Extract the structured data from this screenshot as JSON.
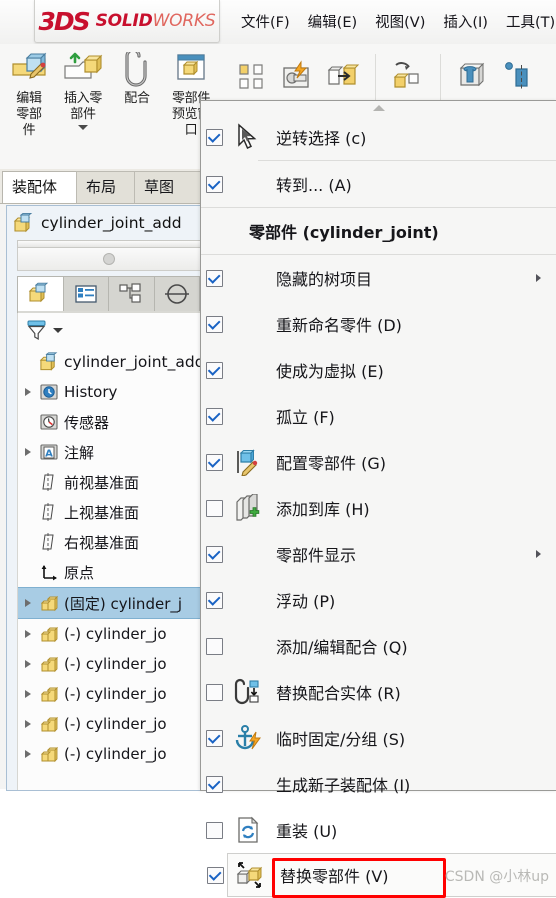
{
  "app": {
    "brand_3ds": "3DS",
    "brand_bold": "SOLID",
    "brand_light": "WORKS",
    "accent_red": "#c8102e",
    "highlight_red": "#ff0000",
    "selection_blue": "#a8cce4"
  },
  "menubar": {
    "items": [
      {
        "label": "文件(F)"
      },
      {
        "label": "编辑(E)"
      },
      {
        "label": "视图(V)"
      },
      {
        "label": "插入(I)"
      },
      {
        "label": "工具(T)"
      }
    ]
  },
  "ribbon": {
    "buttons": [
      {
        "label_line1": "编辑",
        "label_line2": "零部",
        "label_line3": "件",
        "icon": "edit-component-icon",
        "has_caret": false
      },
      {
        "label_line1": "插入零",
        "label_line2": "部件",
        "label_line3": "",
        "icon": "insert-components-icon",
        "has_caret": true
      },
      {
        "label_line1": "配合",
        "label_line2": "",
        "label_line3": "",
        "icon": "mate-icon",
        "has_caret": false
      },
      {
        "label_line1": "零部件",
        "label_line2": "预览窗",
        "label_line3": "口",
        "icon": "component-preview-window-icon",
        "has_caret": false
      }
    ],
    "small_icons": [
      {
        "icon": "linear-component-pattern-icon"
      },
      {
        "icon": "smart-fasteners-icon"
      },
      {
        "icon": "move-component-icon"
      },
      {
        "icon": "show-hide-components-icon"
      },
      {
        "icon": "assembly-features-icon"
      },
      {
        "icon": "reference-geometry-icon"
      }
    ]
  },
  "tabs": {
    "items": [
      {
        "label": "装配体",
        "active": true
      },
      {
        "label": "布局",
        "active": false
      },
      {
        "label": "草图",
        "active": false
      }
    ]
  },
  "doc_panel": {
    "document_title": "cylinder_joint_add",
    "document_icon": "assembly-icon",
    "pm_tabs": [
      {
        "icon": "feature-manager-tree-icon",
        "active": true
      },
      {
        "icon": "property-manager-icon",
        "active": false
      },
      {
        "icon": "configuration-manager-icon",
        "active": false
      },
      {
        "icon": "dimxpert-manager-icon",
        "active": false
      }
    ],
    "filter": {
      "icon": "filter-icon",
      "caret": "chevron-down-icon"
    }
  },
  "tree": {
    "root": {
      "label": "cylinder_joint_add",
      "icon": "assembly-icon"
    },
    "nodes": [
      {
        "label": "History",
        "icon": "history-icon",
        "arrow": true,
        "selected": false
      },
      {
        "label": "传感器",
        "icon": "sensors-icon",
        "arrow": false,
        "selected": false
      },
      {
        "label": "注解",
        "icon": "annotations-icon",
        "arrow": true,
        "selected": false
      },
      {
        "label": "前视基准面",
        "icon": "plane-icon",
        "arrow": false,
        "selected": false
      },
      {
        "label": "上视基准面",
        "icon": "plane-icon",
        "arrow": false,
        "selected": false
      },
      {
        "label": "右视基准面",
        "icon": "plane-icon",
        "arrow": false,
        "selected": false
      },
      {
        "label": "原点",
        "icon": "origin-icon",
        "arrow": false,
        "selected": false
      },
      {
        "label": "(固定) cylinder_j",
        "icon": "part-icon",
        "arrow": true,
        "selected": true
      },
      {
        "label": "(-) cylinder_jo",
        "icon": "part-icon",
        "arrow": true,
        "selected": false
      },
      {
        "label": "(-) cylinder_jo",
        "icon": "part-icon",
        "arrow": true,
        "selected": false
      },
      {
        "label": "(-) cylinder_jo",
        "icon": "part-icon",
        "arrow": true,
        "selected": false
      },
      {
        "label": "(-) cylinder_jo",
        "icon": "part-icon",
        "arrow": true,
        "selected": false
      },
      {
        "label": "(-) cylinder_jo",
        "icon": "part-icon",
        "arrow": true,
        "selected": false
      }
    ]
  },
  "context_menu": {
    "scroll_up_icon": "scroll-up-arrow-icon",
    "header": {
      "label": "零部件 (cylinder_joint)"
    },
    "items": [
      {
        "label": "逆转选择 (c)",
        "checked": true,
        "icon": "invert-selection-icon",
        "submenu": false,
        "divider_after": true,
        "highlighted": false
      },
      {
        "label": "转到... (A)",
        "checked": true,
        "icon": "",
        "submenu": false,
        "divider_after": false,
        "highlighted": false,
        "underline_last": true
      },
      {
        "label": "隐藏的树项目",
        "checked": true,
        "icon": "",
        "submenu": true,
        "divider_after": false,
        "highlighted": false
      },
      {
        "label": "重新命名零件 (D)",
        "checked": true,
        "icon": "",
        "submenu": false,
        "divider_after": false,
        "highlighted": false,
        "underline_last": true
      },
      {
        "label": "使成为虚拟 (E)",
        "checked": true,
        "icon": "",
        "submenu": false,
        "divider_after": false,
        "highlighted": false,
        "underline_last": true
      },
      {
        "label": "孤立 (F)",
        "checked": true,
        "icon": "",
        "submenu": false,
        "divider_after": false,
        "highlighted": false,
        "underline_last": true
      },
      {
        "label": "配置零部件 (G)",
        "checked": true,
        "icon": "configure-component-icon",
        "submenu": false,
        "divider_after": false,
        "highlighted": false,
        "underline_last": true
      },
      {
        "label": "添加到库 (H)",
        "checked": false,
        "icon": "add-to-library-icon",
        "submenu": false,
        "divider_after": false,
        "highlighted": false,
        "underline_last": true
      },
      {
        "label": "零部件显示",
        "checked": true,
        "icon": "",
        "submenu": true,
        "divider_after": false,
        "highlighted": false
      },
      {
        "label": "浮动 (P)",
        "checked": true,
        "icon": "",
        "submenu": false,
        "divider_after": false,
        "highlighted": false,
        "underline_last": true
      },
      {
        "label": "添加/编辑配合 (Q)",
        "checked": false,
        "icon": "",
        "submenu": false,
        "divider_after": false,
        "highlighted": false,
        "underline_last": true
      },
      {
        "label": "替换配合实体 (R)",
        "checked": false,
        "icon": "replace-mate-entity-icon",
        "submenu": false,
        "divider_after": false,
        "highlighted": false,
        "underline_last": true
      },
      {
        "label": "临时固定/分组 (S)",
        "checked": true,
        "icon": "temporary-fix-group-icon",
        "submenu": false,
        "divider_after": false,
        "highlighted": false,
        "underline_last": true
      },
      {
        "label": "生成新子装配体 (I)",
        "checked": true,
        "icon": "",
        "submenu": false,
        "divider_after": false,
        "highlighted": false,
        "underline_last": true
      },
      {
        "label": "重装 (U)",
        "checked": false,
        "icon": "reload-icon",
        "submenu": false,
        "divider_after": false,
        "highlighted": false,
        "underline_last": true
      },
      {
        "label": "替换零部件 (V)",
        "checked": true,
        "icon": "replace-components-icon",
        "submenu": false,
        "divider_after": false,
        "highlighted": true,
        "underline_last": true
      }
    ]
  },
  "watermark": {
    "text": "CSDN @小林up"
  }
}
